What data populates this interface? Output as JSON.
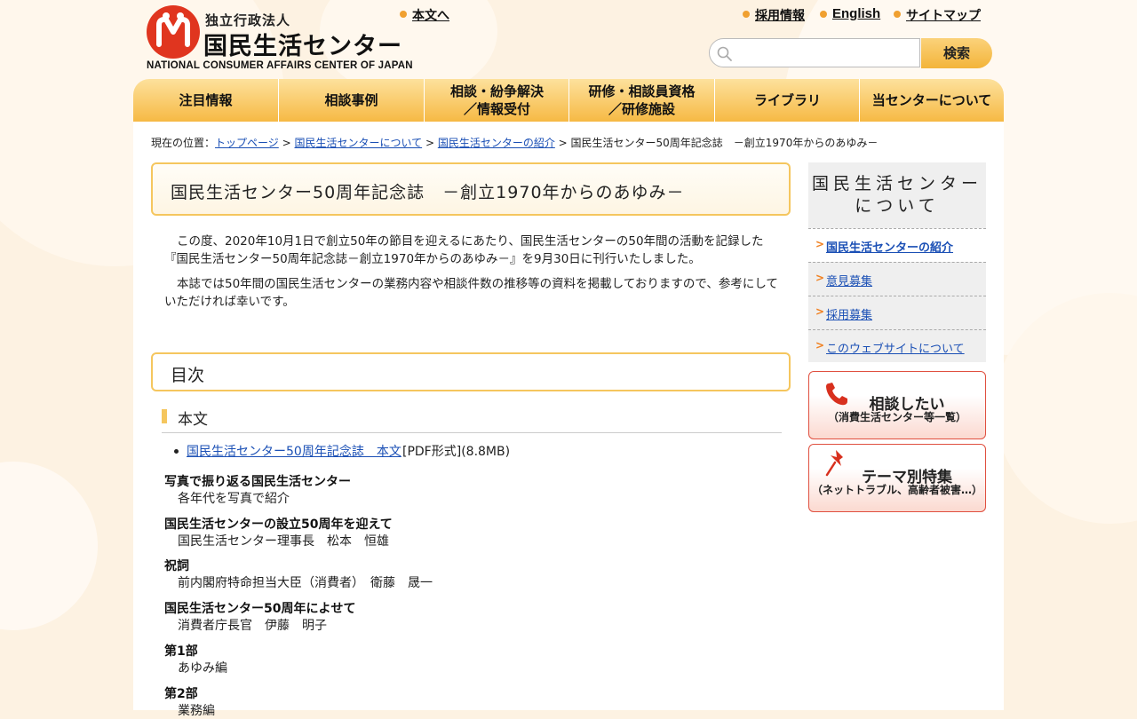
{
  "header": {
    "logo": {
      "sub": "独立行政法人",
      "main": "国民生活センター",
      "en": "NATIONAL CONSUMER AFFAIRS CENTER OF JAPAN"
    },
    "skip_link": "本文へ",
    "links": [
      "採用情報",
      "English",
      "サイトマップ"
    ],
    "search": {
      "placeholder": "",
      "button": "検索"
    }
  },
  "nav": {
    "items": [
      "注目情報",
      "相談事例",
      "相談・紛争解決\n／情報受付",
      "研修・相談員資格\n／研修施設",
      "ライブラリ",
      "当センターについて"
    ]
  },
  "breadcrumb": {
    "prefix": "現在の位置：",
    "links": [
      "トップページ",
      "国民生活センターについて",
      "国民生活センターの紹介"
    ],
    "sep": " > ",
    "current": "国民生活センター50周年記念誌　－創立1970年からのあゆみ－"
  },
  "main": {
    "title": "国民生活センター50周年記念誌　－創立1970年からのあゆみ－",
    "intro": [
      "この度、2020年10月1日で創立50年の節目を迎えるにあたり、国民生活センターの50年間の活動を記録した『国民生活センター50周年記念誌－創立1970年からのあゆみ－』を9月30日に刊行いたしました。",
      "本誌では50年間の国民生活センターの業務内容や相談件数の推移等の資料を掲載しておりますので、参考にしていただければ幸いです。"
    ],
    "toc_heading": "目次",
    "section_heading": "本文",
    "pdf": {
      "link": "国民生活センター50周年記念誌　本文",
      "meta": "[PDF形式](8.8MB)"
    },
    "sections": [
      {
        "title": "写真で振り返る国民生活センター",
        "desc": "各年代を写真で紹介"
      },
      {
        "title": "国民生活センターの設立50周年を迎えて",
        "desc": "国民生活センター理事長　松本　恒雄"
      },
      {
        "title": "祝詞",
        "desc": "前内閣府特命担当大臣（消費者）　衛藤　晟一"
      },
      {
        "title": "国民生活センター50周年によせて",
        "desc": "消費者庁長官　伊藤　明子"
      },
      {
        "title": "第1部",
        "desc": "あゆみ編"
      },
      {
        "title": "第2部",
        "desc": "業務編"
      }
    ]
  },
  "sidebar": {
    "heading": "国民生活センター\nについて",
    "items": [
      "国民生活センターの紹介",
      "意見募集",
      "採用募集",
      "このウェブサイトについて"
    ],
    "banners": [
      {
        "title": "相談したい",
        "sub": "（消費生活センター等一覧）",
        "icon": "phone-icon"
      },
      {
        "title": "テーマ別特集",
        "sub": "（ネットトラブル、高齢者被害…）",
        "icon": "pushpin-icon"
      }
    ]
  },
  "colors": {
    "accent": "#f5c65e",
    "link": "#1a4fb5",
    "logo_red": "#e0351f",
    "bullet_orange": "#f0a030"
  }
}
